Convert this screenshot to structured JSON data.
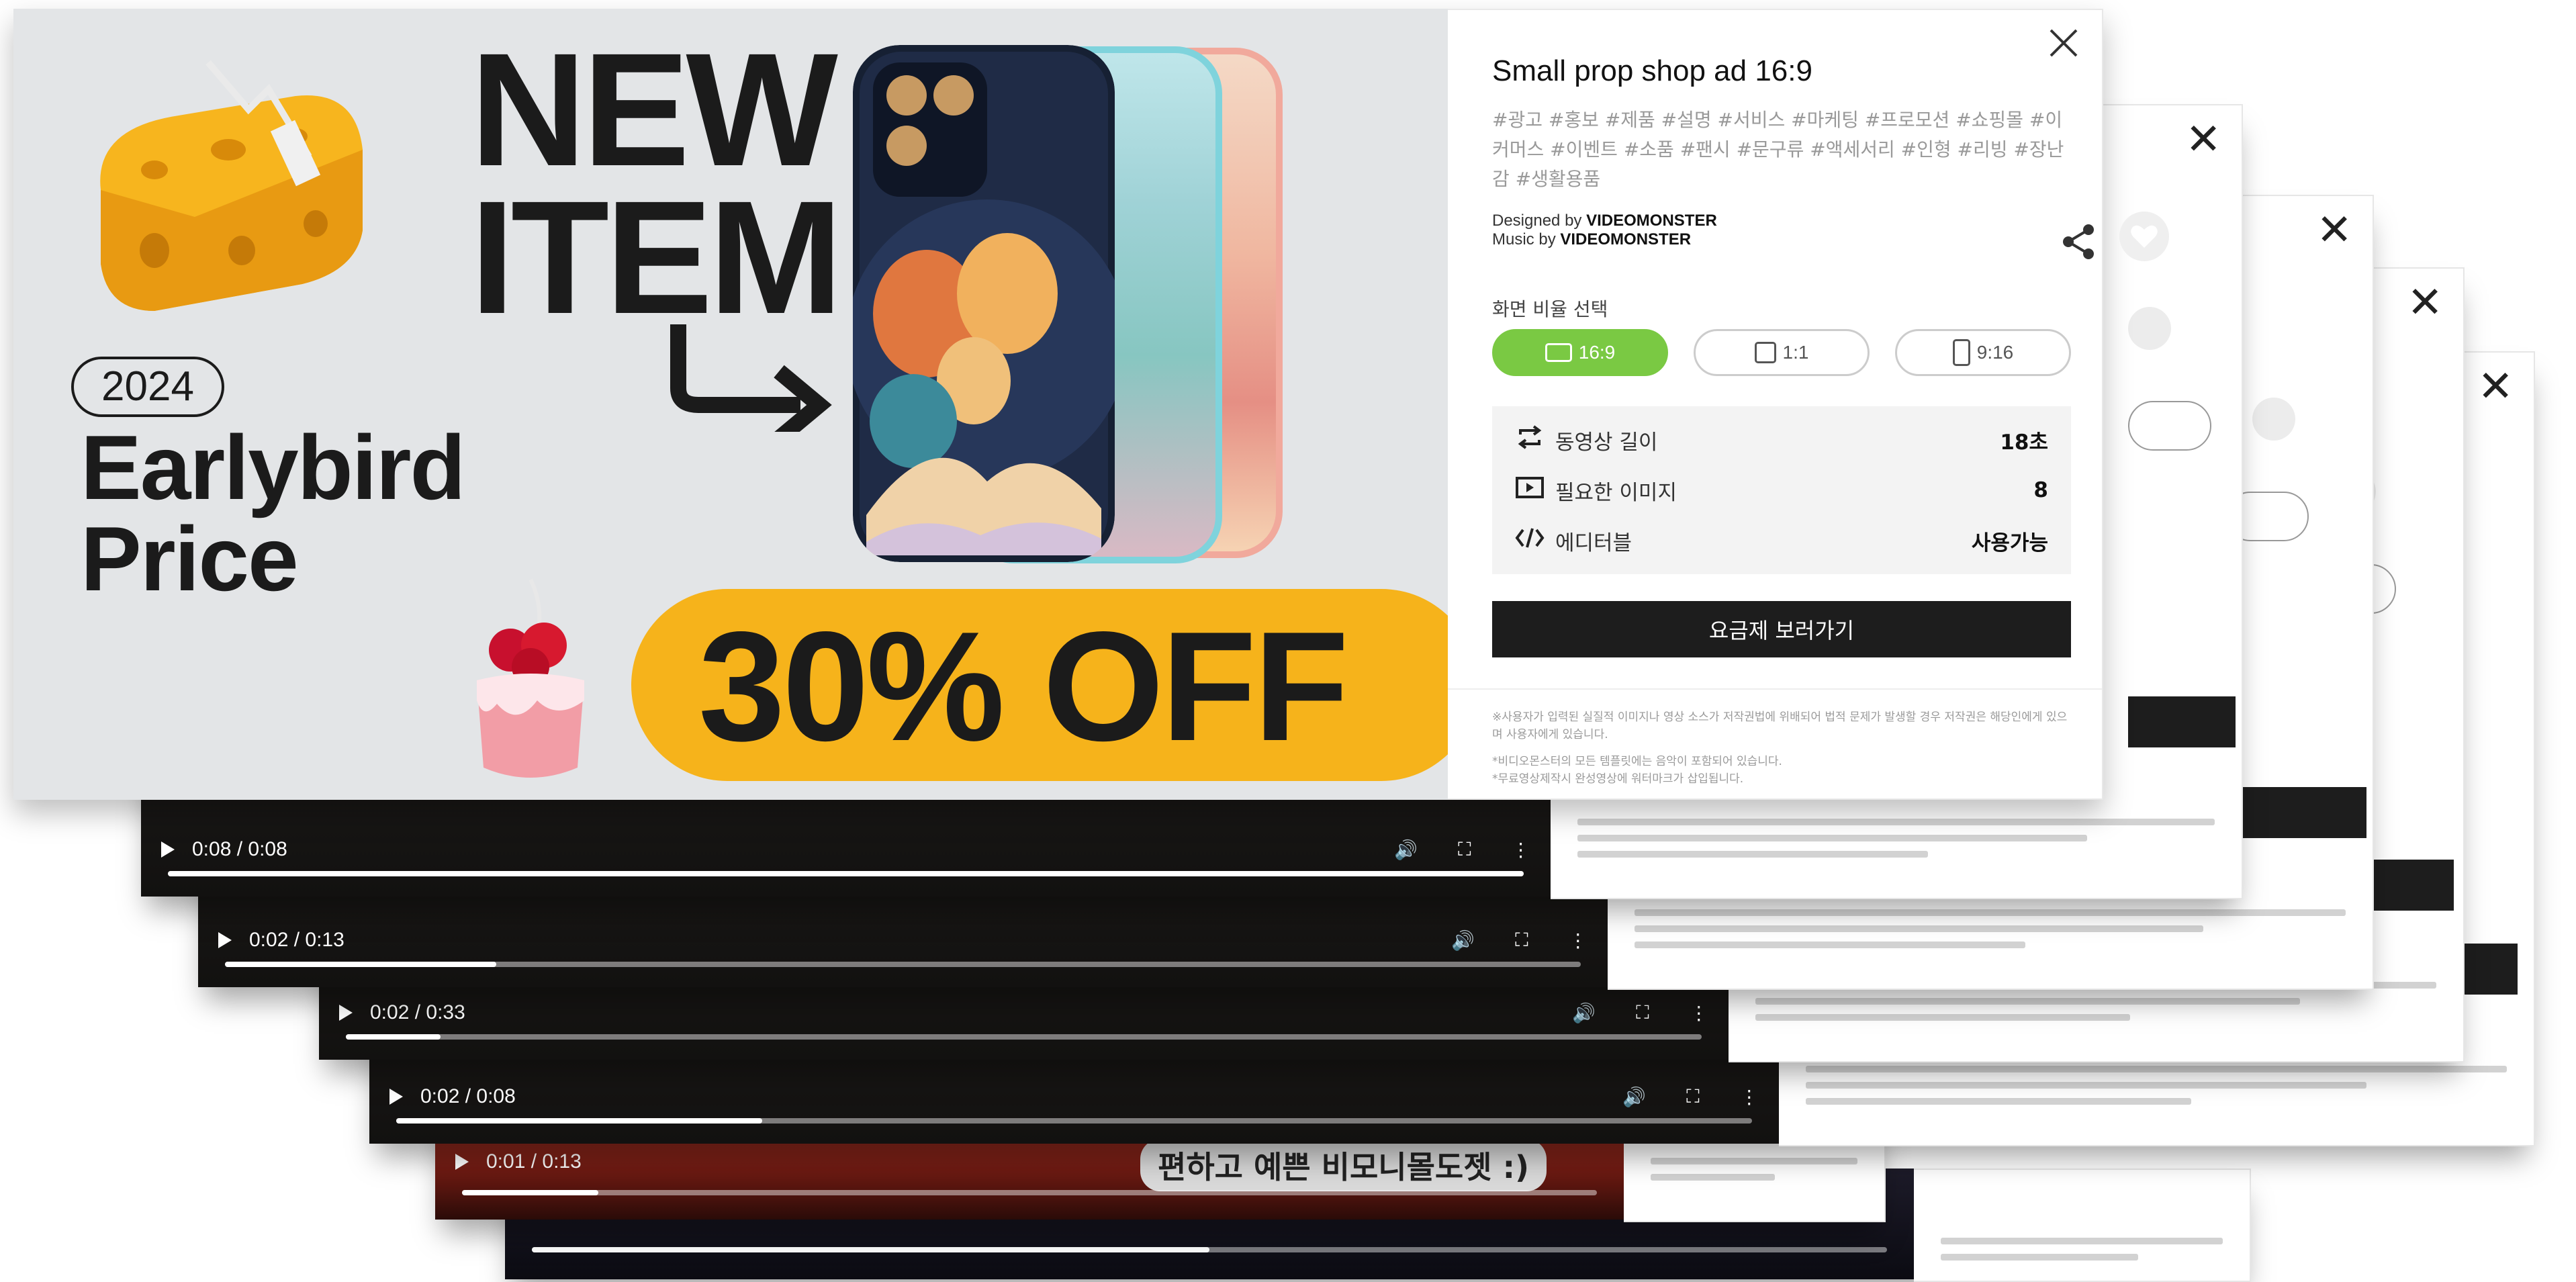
{
  "main_card": {
    "banner": {
      "headline_line1": "NEW",
      "headline_line2": "ITEM",
      "year_badge": "2024",
      "promo_line1": "Earlybird",
      "promo_line2": "Price",
      "discount": "30% OFF"
    },
    "panel": {
      "title": "Small prop shop ad 16:9",
      "tags": "#광고 #홍보 #제품 #설명 #서비스 #마케팅 #프로모션 #쇼핑몰 #이커머스 #이벤트 #소품 #팬시 #문구류 #액세서리 #인형 #리빙 #장난감 #생활용품",
      "designed_by_label": "Designed by",
      "designed_by": "VIDEOMONSTER",
      "music_by_label": "Music by",
      "music_by": "VIDEOMONSTER",
      "ratio_label": "화면 비율 선택",
      "ratios": [
        {
          "label": "16:9",
          "selected": true
        },
        {
          "label": "1:1",
          "selected": false
        },
        {
          "label": "9:16",
          "selected": false
        }
      ],
      "info": [
        {
          "icon": "repeat-icon",
          "label": "동영상 길이",
          "value": "18초"
        },
        {
          "icon": "image-frame-icon",
          "label": "필요한 이미지",
          "value": "8"
        },
        {
          "icon": "code-icon",
          "label": "에디터블",
          "value": "사용가능"
        }
      ],
      "price_button": "요금제 보러가기",
      "disclaimer": [
        "※사용자가 입력된 실질적 이미지나 영상 소스가 저작권법에 위배되어 법적 문제가 발생할 경우 저작권은 해당인에게 있으며 사용자에게 있습니다.",
        "*비디오몬스터의 모든 템플릿에는 음악이 포함되어 있습니다.",
        "*무료영상제작시 완성영상에 워터마크가 삽입됩니다."
      ]
    },
    "colors": {
      "accent_green": "#7ac943",
      "promo_yellow": "#f6b31b",
      "dark": "#1b1b1b"
    }
  },
  "stack_cards": [
    {
      "time": "0:08 / 0:08",
      "progress": 1.0
    },
    {
      "time": "0:02 / 0:13",
      "progress": 0.2
    },
    {
      "time": "0:02 / 0:33",
      "progress": 0.07
    },
    {
      "time": "0:02 / 0:08",
      "progress": 0.27
    },
    {
      "time": "0:01 / 0:13",
      "progress": 0.12,
      "caption": "편하고 예쁜 비모니몰도젯 :)"
    },
    {
      "time": "",
      "progress": 0.5
    }
  ]
}
